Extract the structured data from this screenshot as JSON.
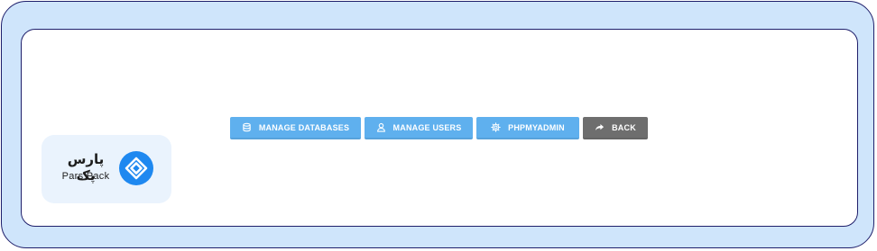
{
  "toolbar": {
    "manage_databases": {
      "label": "MANAGE DATABASES",
      "icon": "database-icon"
    },
    "manage_users": {
      "label": "MANAGE USERS",
      "icon": "user-icon"
    },
    "phpmyadmin": {
      "label": "PHPMYADMIN",
      "icon": "gear-icon"
    },
    "back": {
      "label": "BACK",
      "icon": "share-arrow-icon"
    }
  },
  "logo": {
    "text_fa": "پارس پک",
    "text_en": "Pars Pack"
  },
  "colors": {
    "frame_bg": "#cfe5fb",
    "frame_border": "#1f1f6b",
    "button_blue": "#5fb0ee",
    "button_dark": "#6e6e6e",
    "logo_blue": "#1e88f0",
    "logo_card_bg": "#eaf3fd"
  }
}
